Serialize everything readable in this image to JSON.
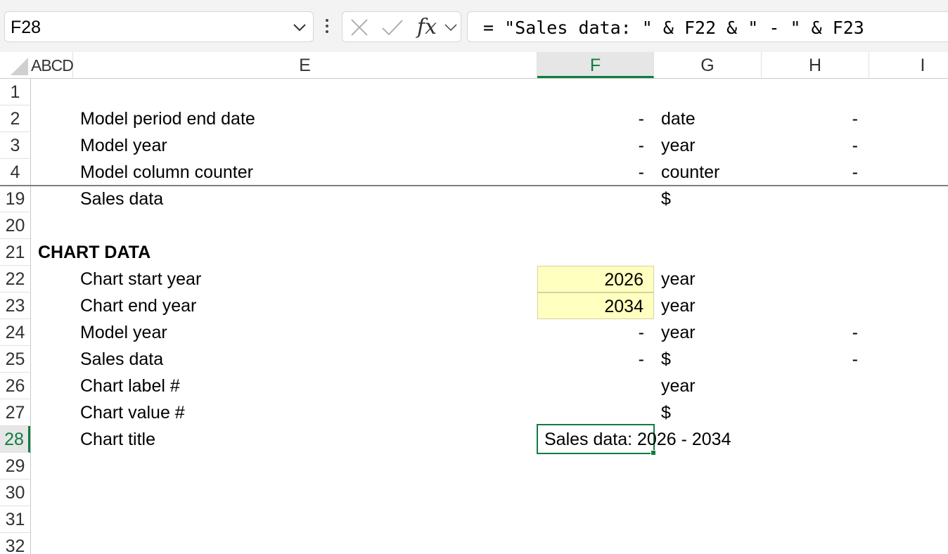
{
  "formula_bar": {
    "name_box": "F28",
    "formula": "= \"Sales data: \" & F22 & \" - \" & F23",
    "fx_label": "fx"
  },
  "columns": [
    "ABCD",
    "E",
    "F",
    "G",
    "H",
    "I"
  ],
  "selected_column": "F",
  "rows": [
    {
      "num": "1",
      "e": "",
      "f": "",
      "g": "",
      "h": ""
    },
    {
      "num": "2",
      "e": "Model period end date",
      "f": "-",
      "g": "date",
      "h": "-"
    },
    {
      "num": "3",
      "e": "Model year",
      "f": "-",
      "g": "year",
      "h": "-"
    },
    {
      "num": "4",
      "e": "Model column counter",
      "f": "-",
      "g": "counter",
      "h": "-"
    },
    {
      "num": "19",
      "e": "Sales data",
      "f": "",
      "g": "$",
      "h": ""
    },
    {
      "num": "20",
      "e": "",
      "f": "",
      "g": "",
      "h": ""
    },
    {
      "num": "21",
      "heading": "CHART DATA"
    },
    {
      "num": "22",
      "e": "Chart start year",
      "f": "2026",
      "g": "year",
      "h": "",
      "input": true
    },
    {
      "num": "23",
      "e": "Chart end year",
      "f": "2034",
      "g": "year",
      "h": "",
      "input": true
    },
    {
      "num": "24",
      "e": "Model year",
      "f": "-",
      "g": "year",
      "h": "-"
    },
    {
      "num": "25",
      "e": "Sales data",
      "f": "-",
      "g": "$",
      "h": "-"
    },
    {
      "num": "26",
      "e": "Chart label #",
      "f": "",
      "g": "year",
      "h": ""
    },
    {
      "num": "27",
      "e": "Chart value #",
      "f": "",
      "g": "$",
      "h": ""
    },
    {
      "num": "28",
      "e": "Chart title",
      "f": "",
      "g": "",
      "h": ""
    },
    {
      "num": "29"
    },
    {
      "num": "30"
    },
    {
      "num": "31"
    },
    {
      "num": "32"
    }
  ],
  "selected_row": "28",
  "active_cell": {
    "address": "F28",
    "display": "Sales data: 2026 - 2034"
  }
}
